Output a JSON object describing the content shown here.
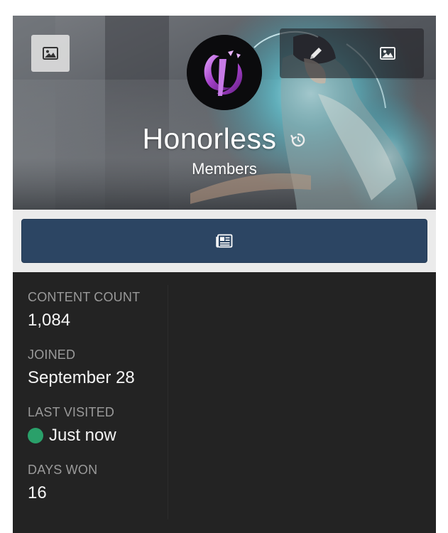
{
  "profile": {
    "name": "Honorless",
    "group": "Members"
  },
  "cover": {
    "left_button_icon": "image-icon",
    "edit_button_icon": "pencil-icon",
    "right_button_icon": "image-icon",
    "history_icon": "history-icon"
  },
  "content_button": {
    "icon": "newspaper-icon",
    "color": "#2c4563"
  },
  "stats": [
    {
      "label": "CONTENT COUNT",
      "value": "1,084"
    },
    {
      "label": "JOINED",
      "value": "September 28"
    },
    {
      "label": "LAST VISITED",
      "value": "Just now",
      "status_color": "#2aa06a"
    },
    {
      "label": "DAYS WON",
      "value": "16"
    }
  ]
}
